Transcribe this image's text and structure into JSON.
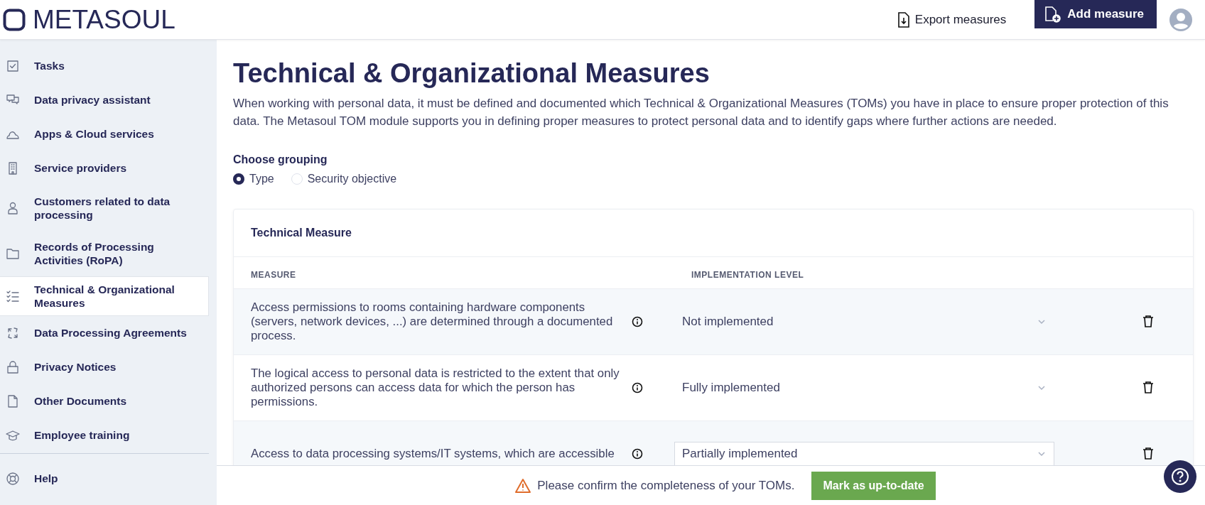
{
  "header": {
    "logo": "METASOUL",
    "export_button": "Export measures",
    "add_button": "Add measure"
  },
  "sidebar": {
    "items": [
      {
        "label": "Tasks",
        "selected": false
      },
      {
        "label": "Data privacy assistant",
        "selected": false
      },
      {
        "label": "Apps & Cloud services",
        "selected": false
      },
      {
        "label": "Service providers",
        "selected": false
      },
      {
        "label": "Customers related to data processing",
        "selected": false
      },
      {
        "label": "Records of Processing Activities (RoPA)",
        "selected": false
      },
      {
        "label": "Technical & Organizational Measures",
        "selected": true
      },
      {
        "label": "Data Processing Agreements",
        "selected": false
      },
      {
        "label": "Privacy Notices",
        "selected": false
      },
      {
        "label": "Other Documents",
        "selected": false
      },
      {
        "label": "Employee training",
        "selected": false
      }
    ],
    "help": "Help"
  },
  "page": {
    "title": "Technical & Organizational Measures",
    "description": "When working with personal data, it must be defined and documented which Technical & Organizational Measures (TOMs) you have in place to ensure proper protection of this data. The Metasoul TOM module supports you in defining proper measures to protect personal data and to identify gaps where further actions are needed.",
    "grouping": {
      "label": "Choose grouping",
      "options": [
        {
          "label": "Type",
          "selected": true
        },
        {
          "label": "Security objective",
          "selected": false
        }
      ]
    }
  },
  "table": {
    "title": "Technical Measure",
    "columns": [
      "MEASURE",
      "IMPLEMENTATION LEVEL"
    ],
    "rows": [
      {
        "measure": "Access permissions to rooms containing hardware components (servers, network devices, ...) are determined through a documented process.",
        "level": "Not implemented",
        "focused": false
      },
      {
        "measure": "The logical access to personal data is restricted to the extent that only authorized persons can access data for which the person has permissions.",
        "level": "Fully implemented",
        "focused": false
      },
      {
        "measure": "Access to data processing systems/IT systems, which are accessible",
        "level": "Partially implemented",
        "focused": true
      }
    ]
  },
  "footer": {
    "message": "Please confirm the completeness of your TOMs.",
    "button": "Mark as up-to-date"
  }
}
